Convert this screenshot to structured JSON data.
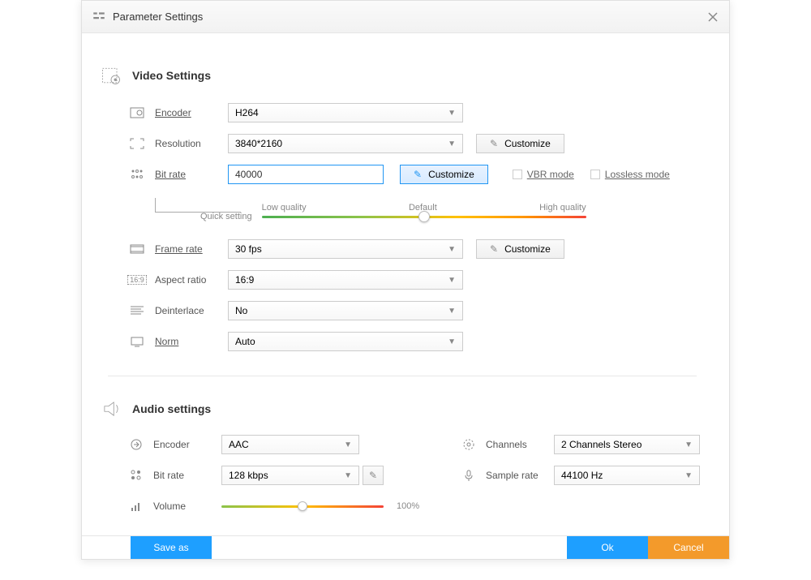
{
  "window": {
    "title": "Parameter Settings"
  },
  "video": {
    "section_title": "Video Settings",
    "encoder_label": "Encoder",
    "encoder_value": "H264",
    "resolution_label": "Resolution",
    "resolution_value": "3840*2160",
    "resolution_customize": "Customize",
    "bitrate_label": "Bit rate",
    "bitrate_value": "40000",
    "bitrate_customize": "Customize",
    "vbr_label": "VBR mode",
    "lossless_label": "Lossless mode",
    "quick_setting_label": "Quick setting",
    "q_low": "Low quality",
    "q_default": "Default",
    "q_high": "High quality",
    "framerate_label": "Frame rate",
    "framerate_value": "30 fps",
    "framerate_customize": "Customize",
    "aspect_label": "Aspect ratio",
    "aspect_value": "16:9",
    "deinterlace_label": "Deinterlace",
    "deinterlace_value": "No",
    "norm_label": "Norm",
    "norm_value": "Auto"
  },
  "audio": {
    "section_title": "Audio settings",
    "encoder_label": "Encoder",
    "encoder_value": "AAC",
    "channels_label": "Channels",
    "channels_value": "2 Channels Stereo",
    "bitrate_label": "Bit rate",
    "bitrate_value": "128 kbps",
    "samplerate_label": "Sample rate",
    "samplerate_value": "44100 Hz",
    "volume_label": "Volume",
    "volume_display": "100%"
  },
  "buttons": {
    "save_as": "Save as",
    "ok": "Ok",
    "cancel": "Cancel"
  }
}
